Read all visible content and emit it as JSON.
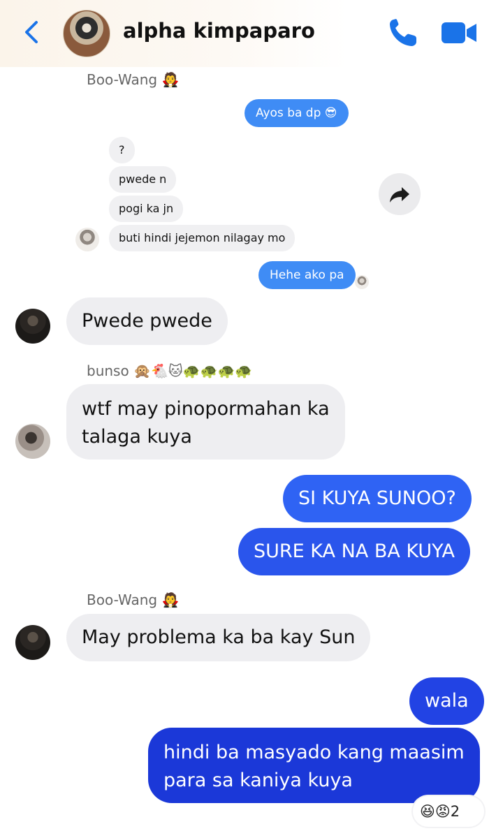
{
  "header": {
    "title": "alpha kimpaparo",
    "accent": "#1a73e8"
  },
  "messages": {
    "sender_boowang_1": {
      "name": "Boo-Wang",
      "emoji": "🧛"
    },
    "ayos": "Ayos ba dp 😎",
    "q": "?",
    "pwede_n": "pwede n",
    "pogi": "pogi ka jn",
    "buti": "buti hindi jejemon nilagay mo",
    "hehe": "Hehe ako pa",
    "pwede_pwede": "Pwede pwede",
    "sender_bunso": {
      "name": "bunso",
      "emoji": "🙊🐔🐱🐢🐢🐢🐢"
    },
    "wtf_1": "wtf may pinopormahan ka",
    "wtf_2": "talaga kuya",
    "si_kuya": "SI KUYA SUNOO?",
    "sure": "SURE KA NA BA KUYA",
    "sender_boowang_2": {
      "name": "Boo-Wang",
      "emoji": "🧛"
    },
    "may_problema": "May problema ka ba kay Sun",
    "wala": "wala",
    "hindi_1": "hindi ba masyado kang maasim",
    "hindi_2": "para sa kaniya kuya"
  },
  "reactions": {
    "emojis": "😆😡",
    "count": "2"
  },
  "colors": {
    "outgoing_light": "#3f8cf5",
    "outgoing_gradient_top": "#2f6bf2",
    "outgoing_gradient_bottom": "#1637d6",
    "incoming": "#eeeef1"
  }
}
